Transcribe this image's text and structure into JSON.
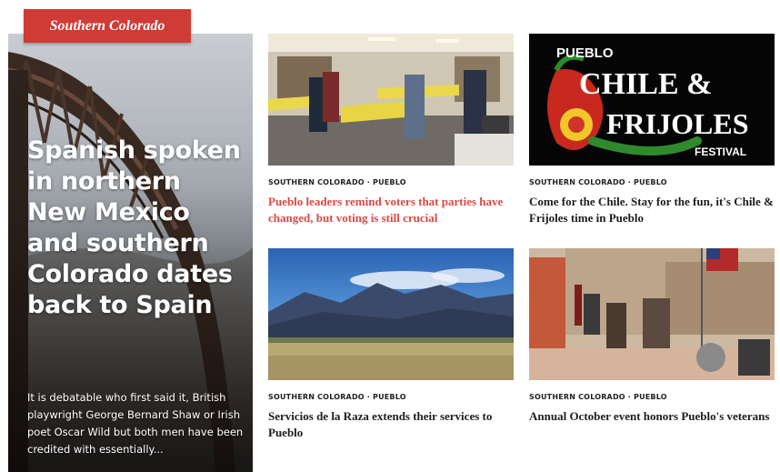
{
  "section": {
    "label": "Southern Colorado"
  },
  "feature": {
    "title": "Spanish spoken in northern New Mexico and southern Colorado dates back to Spain",
    "excerpt": "It is debatable who first said it, British playwright George Bernard Shaw or Irish poet Oscar Wild but both men have been credited with essentially..."
  },
  "cards": [
    {
      "meta": "SOUTHERN COLORADO · PUEBLO",
      "headline": "Pueblo leaders remind voters that parties have changed, but voting is still crucial"
    },
    {
      "meta": "SOUTHERN COLORADO · PUEBLO",
      "headline": "Come for the Chile. Stay for the fun, it's Chile & Frijoles time in Pueblo",
      "thumb_text": {
        "line1": "PUEBLO",
        "line2": "CHILE &",
        "line3": "FRIJOLES",
        "line4": "FESTIVAL"
      }
    },
    {
      "meta": "SOUTHERN COLORADO · PUEBLO",
      "headline": "Servicios de la Raza extends their services to Pueblo"
    },
    {
      "meta": "SOUTHERN COLORADO · PUEBLO",
      "headline": "Annual October event honors Pueblo's veterans"
    }
  ],
  "colors": {
    "accent": "#d13b36",
    "headline_highlight": "#d94a45"
  }
}
